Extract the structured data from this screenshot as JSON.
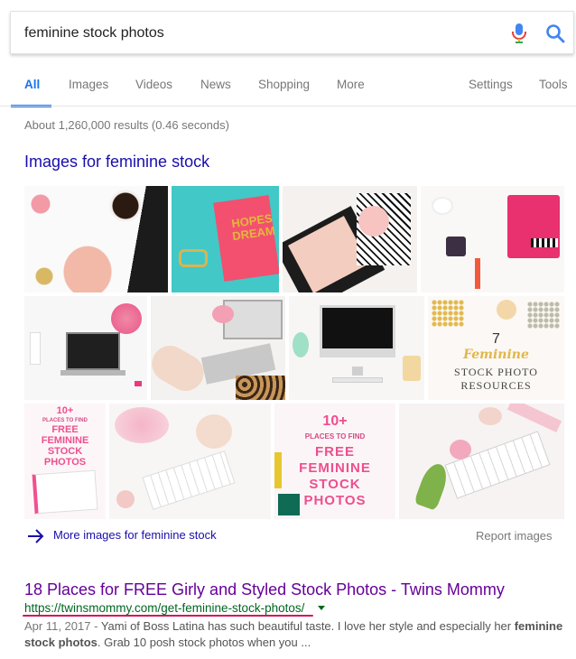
{
  "search": {
    "query": "feminine stock photos"
  },
  "tabs": [
    {
      "label": "All",
      "active": true
    },
    {
      "label": "Images"
    },
    {
      "label": "Videos"
    },
    {
      "label": "News"
    },
    {
      "label": "Shopping"
    },
    {
      "label": "More"
    },
    {
      "label": "Settings"
    },
    {
      "label": "Tools"
    }
  ],
  "stats": "About 1,260,000 results (0.46 seconds)",
  "images_section": {
    "heading": "Images for feminine stock",
    "thumbs": [
      {
        "alt": "pink desk flatlay with coffee and keyboard"
      },
      {
        "alt": "teal desk with pink notebook"
      },
      {
        "alt": "black tablet with pink rose"
      },
      {
        "alt": "white desk with pink planner"
      },
      {
        "alt": "laptop with pink flowers"
      },
      {
        "alt": "woman typing on laptop"
      },
      {
        "alt": "iMac on white desk"
      },
      {
        "alt": "7 Feminine Stock Photo Resources",
        "text": [
          "7",
          "Feminine",
          "STOCK PHOTO",
          "RESOURCES"
        ]
      },
      {
        "alt": "10+ places to find free feminine stock photos",
        "text": [
          "10+",
          "PLACES TO FIND",
          "FREE",
          "FEMININE",
          "STOCK",
          "PHOTOS"
        ]
      },
      {
        "alt": "pink roses with white keyboard"
      },
      {
        "alt": "10+ places to find free feminine stock photos",
        "text": [
          "10+",
          "PLACES TO FIND",
          "FREE",
          "FEMININE",
          "STOCK",
          "PHOTOS"
        ]
      },
      {
        "alt": "keyboard with tulips and pink ribbon"
      }
    ],
    "more_label": "More images for feminine stock",
    "report_label": "Report images"
  },
  "result": {
    "title": "18 Places for FREE Girly and Styled Stock Photos - Twins Mommy",
    "url": "https://twinsmommy.com/get-feminine-stock-photos/",
    "date": "Apr 11, 2017 - ",
    "snippet_1": "Yami of Boss Latina has such beautiful taste. I love her style and especially her ",
    "snippet_bold_1": "feminine stock photos",
    "snippet_2": ". Grab 10 posh stock photos when you ..."
  },
  "colors": {
    "link": "#1a0dab",
    "visited": "#660099",
    "url_green": "#006621",
    "active_tab": "#1a73e8",
    "annotation": "#d51557"
  }
}
